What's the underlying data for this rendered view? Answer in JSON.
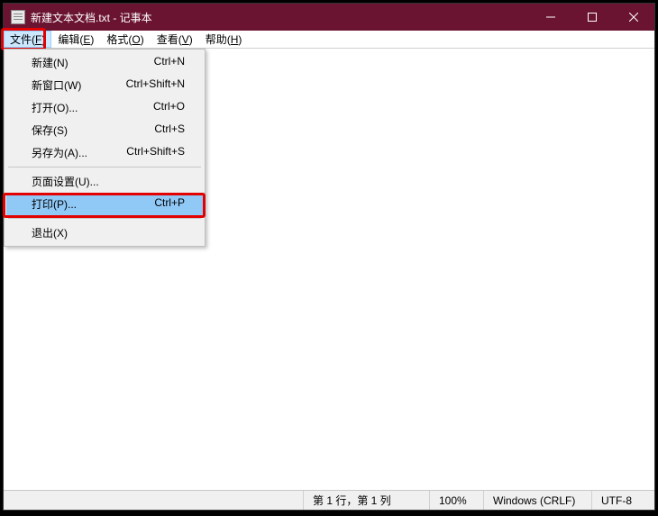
{
  "title": "新建文本文档.txt - 记事本",
  "menubar": {
    "file": {
      "label": "文件(",
      "hotkey": "F",
      "tail": ")"
    },
    "edit": {
      "label": "编辑(",
      "hotkey": "E",
      "tail": ")"
    },
    "format": {
      "label": "格式(",
      "hotkey": "O",
      "tail": ")"
    },
    "view": {
      "label": "查看(",
      "hotkey": "V",
      "tail": ")"
    },
    "help": {
      "label": "帮助(",
      "hotkey": "H",
      "tail": ")"
    }
  },
  "file_menu": {
    "new": {
      "label": "新建(N)",
      "shortcut": "Ctrl+N"
    },
    "new_window": {
      "label": "新窗口(W)",
      "shortcut": "Ctrl+Shift+N"
    },
    "open": {
      "label": "打开(O)...",
      "shortcut": "Ctrl+O"
    },
    "save": {
      "label": "保存(S)",
      "shortcut": "Ctrl+S"
    },
    "save_as": {
      "label": "另存为(A)...",
      "shortcut": "Ctrl+Shift+S"
    },
    "page_setup": {
      "label": "页面设置(U)...",
      "shortcut": ""
    },
    "print": {
      "label": "打印(P)...",
      "shortcut": "Ctrl+P"
    },
    "exit": {
      "label": "退出(X)",
      "shortcut": ""
    }
  },
  "statusbar": {
    "position": "第 1 行，第 1 列",
    "zoom": "100%",
    "line_ending": "Windows (CRLF)",
    "encoding": "UTF-8"
  }
}
